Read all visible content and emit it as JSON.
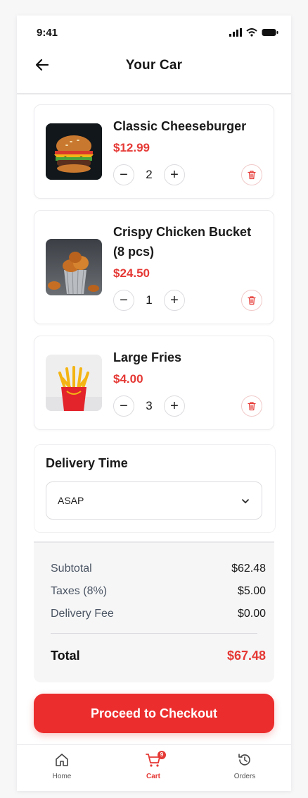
{
  "status_bar": {
    "time": "9:41"
  },
  "header": {
    "title": "Your Car"
  },
  "cart_items": [
    {
      "name": "Classic Cheeseburger",
      "price": "$12.99",
      "quantity": "2",
      "decrease_label": "−",
      "increase_label": "+"
    },
    {
      "name": "Crispy Chicken Bucket (8 pcs)",
      "price": "$24.50",
      "quantity": "1",
      "decrease_label": "−",
      "increase_label": "+"
    },
    {
      "name": "Large Fries",
      "price": "$4.00",
      "quantity": "3",
      "decrease_label": "−",
      "increase_label": "+"
    }
  ],
  "delivery": {
    "label": "Delivery Time",
    "selected": "ASAP"
  },
  "summary": {
    "subtotal_label": "Subtotal",
    "subtotal": "$62.48",
    "taxes_label": "Taxes (8%)",
    "taxes": "$5.00",
    "delivery_fee_label": "Delivery Fee",
    "delivery_fee": "$0.00",
    "total_label": "Total",
    "total": "$67.48"
  },
  "checkout_label": "Proceed to Checkout",
  "nav": {
    "home": "Home",
    "cart": "Cart",
    "cart_badge": "9",
    "orders": "Orders"
  },
  "colors": {
    "accent": "#ec2d2d",
    "price": "#e53935"
  },
  "icons": [
    "back-arrow-icon",
    "signal-icon",
    "wifi-icon",
    "battery-icon",
    "trash-icon",
    "chevron-down-icon",
    "home-icon",
    "cart-icon",
    "orders-history-icon"
  ]
}
